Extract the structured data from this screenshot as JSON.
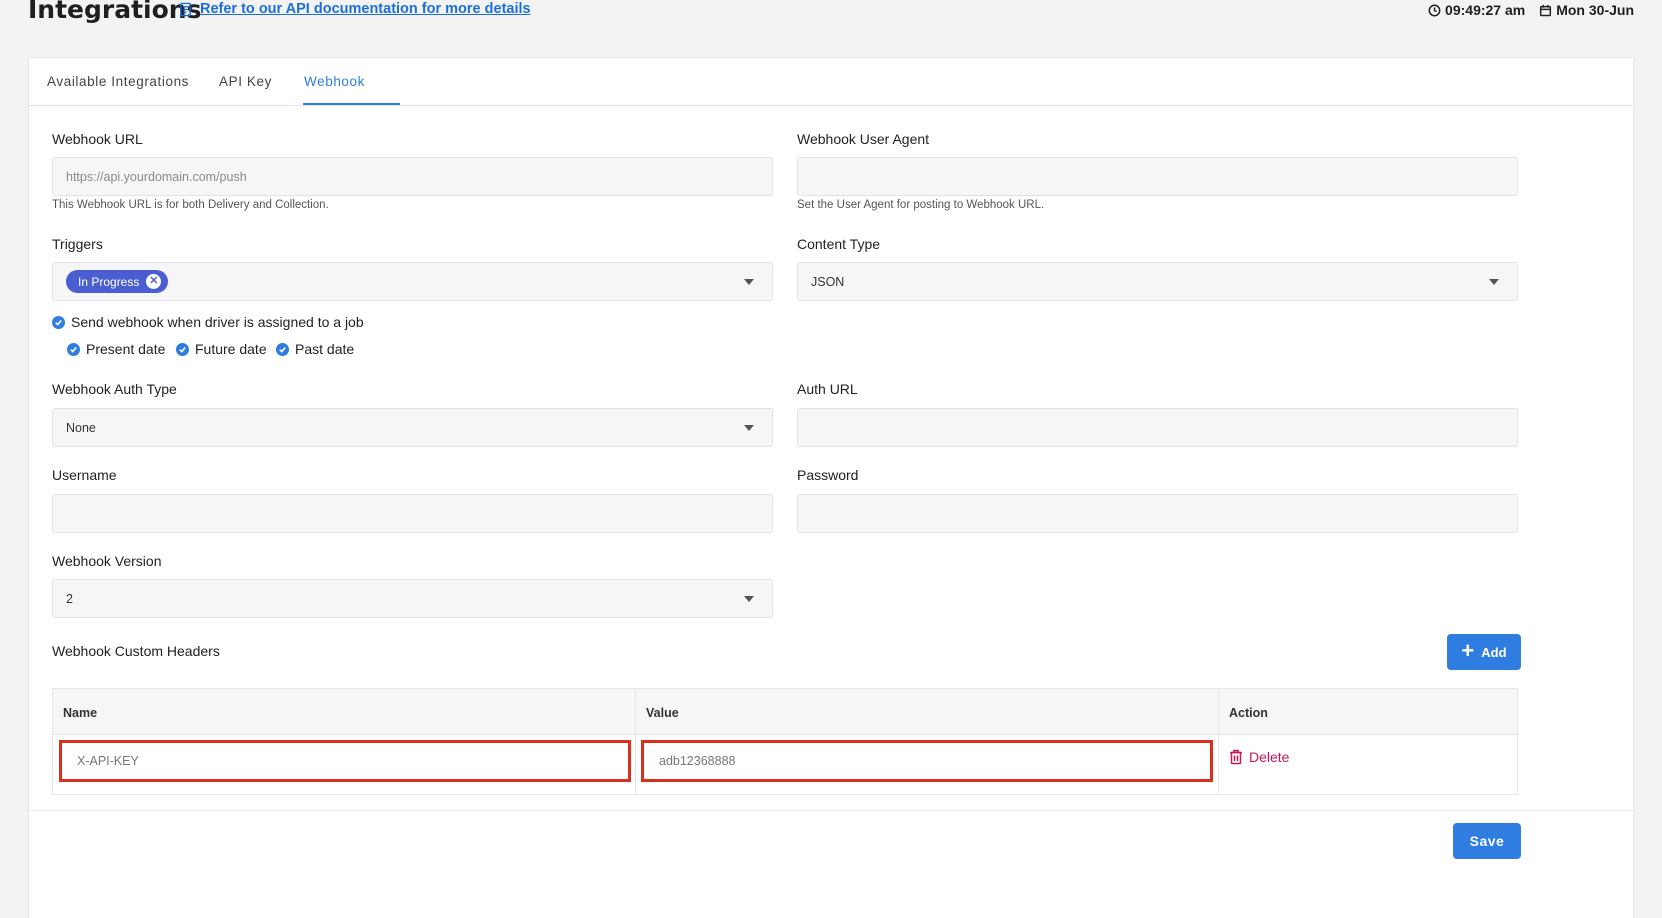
{
  "header": {
    "title": "Integrations",
    "doc_link": "Refer to our API documentation for more details",
    "time": "09:49:27 am",
    "date": "Mon 30-Jun"
  },
  "tabs": [
    {
      "label": "Available Integrations"
    },
    {
      "label": "API Key"
    },
    {
      "label": "Webhook",
      "active": true
    }
  ],
  "form": {
    "webhook_url": {
      "label": "Webhook URL",
      "placeholder": "https://api.yourdomain.com/push",
      "hint": "This Webhook URL is for both Delivery and Collection."
    },
    "user_agent": {
      "label": "Webhook User Agent",
      "value": "",
      "hint": "Set the User Agent for posting to Webhook URL."
    },
    "triggers": {
      "label": "Triggers",
      "chips": [
        "In Progress"
      ]
    },
    "content_type": {
      "label": "Content Type",
      "value": "JSON"
    },
    "driver_assigned": {
      "label": "Send webhook when driver is assigned to a job",
      "checked": true
    },
    "date_options": [
      {
        "label": "Present date",
        "checked": true
      },
      {
        "label": "Future date",
        "checked": true
      },
      {
        "label": "Past date",
        "checked": true
      }
    ],
    "auth_type": {
      "label": "Webhook Auth Type",
      "value": "None"
    },
    "auth_url": {
      "label": "Auth URL",
      "value": ""
    },
    "username": {
      "label": "Username",
      "value": ""
    },
    "password": {
      "label": "Password",
      "value": ""
    },
    "version": {
      "label": "Webhook Version",
      "value": "2"
    }
  },
  "custom_headers": {
    "title": "Webhook Custom Headers",
    "add_label": "Add",
    "columns": [
      "Name",
      "Value",
      "Action"
    ],
    "rows": [
      {
        "name": "X-API-KEY",
        "value": "adb12368888",
        "action": "Delete"
      }
    ]
  },
  "save_label": "Save",
  "colors": {
    "accent": "#2f7de1",
    "chip": "#4a5ed2",
    "highlight": "#d9301e",
    "delete": "#c2185b"
  }
}
